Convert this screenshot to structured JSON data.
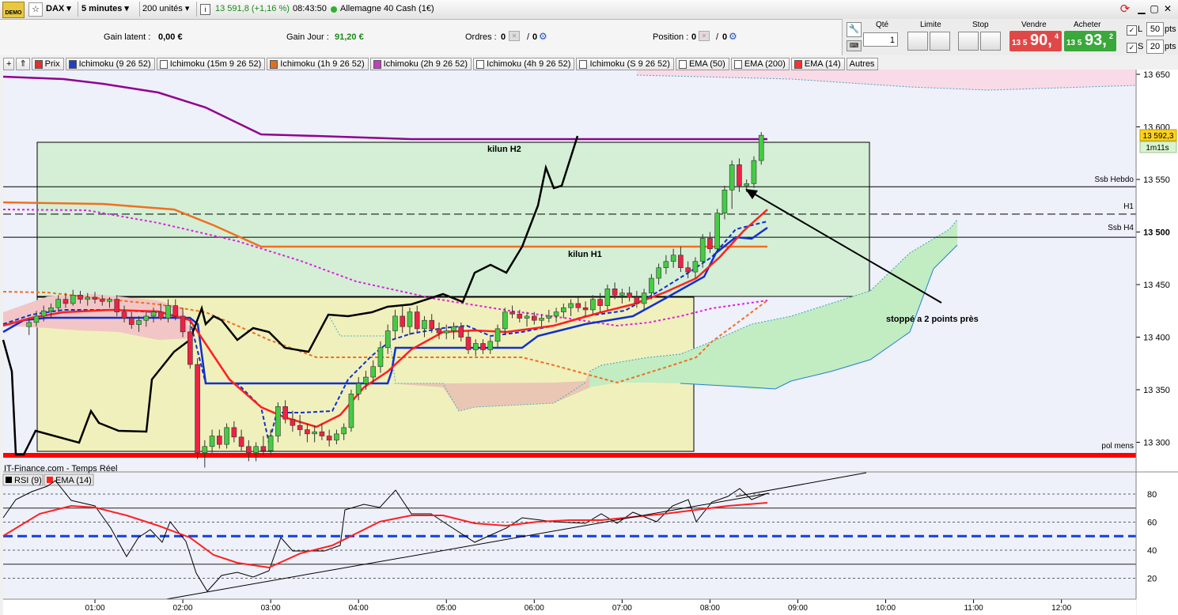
{
  "toolbar": {
    "symbol": "DAX",
    "timeframe": "5 minutes",
    "units": "200 unités",
    "price": "13 591,8",
    "change": "(+1,16 %)",
    "time": "08:43:50",
    "instrument": "Allemagne 40 Cash (1€)"
  },
  "info": {
    "gain_latent_label": "Gain latent :",
    "gain_latent": "0,00 €",
    "gain_jour_label": "Gain Jour :",
    "gain_jour": "91,20 €",
    "ordres_label": "Ordres :",
    "ordres_a": "0",
    "ordres_b": "0",
    "position_label": "Position :",
    "position_a": "0",
    "position_b": "0"
  },
  "trade": {
    "qty_label": "Qté",
    "qty_value": "1",
    "limit_label": "Limite",
    "stop_label": "Stop",
    "sell_label": "Vendre",
    "sell_small": "13 5",
    "sell_big": "90,",
    "sell_sup": "4",
    "buy_label": "Acheter",
    "buy_small": "13 5",
    "buy_big": "93,",
    "buy_sup": "2",
    "l_label": "L",
    "l_value": "50",
    "s_label": "S",
    "s_value": "20",
    "pts": "pts"
  },
  "legend": [
    {
      "label": "Prix",
      "color": "#e03030"
    },
    {
      "label": "Ichimoku (9 26 52)",
      "color": "#2040c0"
    },
    {
      "label": "Ichimoku (15m 9 26 52)",
      "color": "#ffffff"
    },
    {
      "label": "Ichimoku (1h 9 26 52)",
      "color": "#e07020"
    },
    {
      "label": "Ichimoku (2h 9 26 52)",
      "color": "#c040c0"
    },
    {
      "label": "Ichimoku (4h 9 26 52)",
      "color": "#ffffff"
    },
    {
      "label": "Ichimoku (S 9 26 52)",
      "color": "#ffffff"
    },
    {
      "label": "EMA (50)",
      "color": "#ffffff"
    },
    {
      "label": "EMA (200)",
      "color": "#ffffff"
    },
    {
      "label": "EMA (14)",
      "color": "#ff3030"
    },
    {
      "label": "Autres",
      "color": ""
    }
  ],
  "chart_data": [
    {
      "type": "line",
      "subtype": "candlestick",
      "title": "",
      "xlabel": "",
      "ylabel": "",
      "ylim": [
        13280,
        13660
      ],
      "xlim": [
        "00:10",
        "12:55"
      ],
      "x_ticks": [
        "01:00",
        "02:00",
        "03:00",
        "04:00",
        "05:00",
        "06:00",
        "07:00",
        "08:00",
        "09:00",
        "10:00",
        "11:00",
        "12:00"
      ],
      "y_ticks": [
        "13 650",
        "13 600",
        "13 550",
        "13 500",
        "13 450",
        "13 400",
        "13 350",
        "13 300"
      ],
      "current_price_label": "13 592,3",
      "countdown_label": "1m11s",
      "horizontal_levels": [
        {
          "label": "Ssb Hebdo",
          "value": 13543,
          "style": "solid"
        },
        {
          "label": "H1",
          "value": 13517,
          "style": "dashed"
        },
        {
          "label": "Ssb H4",
          "value": 13495,
          "style": "solid"
        },
        {
          "label": "pol mens",
          "value": 13286,
          "style": "thick-red"
        }
      ],
      "annotations": [
        "kilun H2",
        "kilun H1",
        "stoppé a 2 points près"
      ],
      "candles": [
        {
          "t": "00:15",
          "o": 13410,
          "h": 13418,
          "l": 13402,
          "c": 13414
        },
        {
          "t": "00:20",
          "o": 13414,
          "h": 13425,
          "l": 13410,
          "c": 13420
        },
        {
          "t": "00:25",
          "o": 13420,
          "h": 13430,
          "l": 13415,
          "c": 13425
        },
        {
          "t": "00:30",
          "o": 13425,
          "h": 13432,
          "l": 13418,
          "c": 13428
        },
        {
          "t": "00:35",
          "o": 13428,
          "h": 13440,
          "l": 13424,
          "c": 13436
        },
        {
          "t": "00:40",
          "o": 13436,
          "h": 13442,
          "l": 13428,
          "c": 13432
        },
        {
          "t": "00:45",
          "o": 13432,
          "h": 13445,
          "l": 13430,
          "c": 13440
        },
        {
          "t": "00:50",
          "o": 13440,
          "h": 13444,
          "l": 13432,
          "c": 13436
        },
        {
          "t": "00:55",
          "o": 13436,
          "h": 13442,
          "l": 13430,
          "c": 13438
        },
        {
          "t": "01:00",
          "o": 13438,
          "h": 13443,
          "l": 13432,
          "c": 13436
        },
        {
          "t": "01:05",
          "o": 13436,
          "h": 13440,
          "l": 13430,
          "c": 13434
        },
        {
          "t": "01:10",
          "o": 13434,
          "h": 13438,
          "l": 13428,
          "c": 13436
        },
        {
          "t": "01:15",
          "o": 13436,
          "h": 13440,
          "l": 13420,
          "c": 13424
        },
        {
          "t": "01:20",
          "o": 13424,
          "h": 13430,
          "l": 13414,
          "c": 13418
        },
        {
          "t": "01:25",
          "o": 13418,
          "h": 13424,
          "l": 13408,
          "c": 13412
        },
        {
          "t": "01:30",
          "o": 13412,
          "h": 13420,
          "l": 13405,
          "c": 13416
        },
        {
          "t": "01:35",
          "o": 13416,
          "h": 13424,
          "l": 13410,
          "c": 13420
        },
        {
          "t": "01:40",
          "o": 13420,
          "h": 13428,
          "l": 13414,
          "c": 13424
        },
        {
          "t": "01:45",
          "o": 13424,
          "h": 13432,
          "l": 13416,
          "c": 13418
        },
        {
          "t": "01:50",
          "o": 13418,
          "h": 13436,
          "l": 13414,
          "c": 13430
        },
        {
          "t": "01:55",
          "o": 13430,
          "h": 13436,
          "l": 13416,
          "c": 13420
        },
        {
          "t": "02:00",
          "o": 13420,
          "h": 13428,
          "l": 13400,
          "c": 13405
        },
        {
          "t": "02:05",
          "o": 13405,
          "h": 13412,
          "l": 13370,
          "c": 13374
        },
        {
          "t": "02:10",
          "o": 13374,
          "h": 13380,
          "l": 13284,
          "c": 13290
        },
        {
          "t": "02:15",
          "o": 13290,
          "h": 13302,
          "l": 13276,
          "c": 13296
        },
        {
          "t": "02:20",
          "o": 13296,
          "h": 13312,
          "l": 13290,
          "c": 13306
        },
        {
          "t": "02:25",
          "o": 13306,
          "h": 13312,
          "l": 13294,
          "c": 13298
        },
        {
          "t": "02:30",
          "o": 13298,
          "h": 13318,
          "l": 13294,
          "c": 13314
        },
        {
          "t": "02:35",
          "o": 13314,
          "h": 13320,
          "l": 13300,
          "c": 13305
        },
        {
          "t": "02:40",
          "o": 13305,
          "h": 13312,
          "l": 13292,
          "c": 13296
        },
        {
          "t": "02:45",
          "o": 13296,
          "h": 13302,
          "l": 13282,
          "c": 13290
        },
        {
          "t": "02:50",
          "o": 13290,
          "h": 13300,
          "l": 13282,
          "c": 13296
        },
        {
          "t": "02:55",
          "o": 13296,
          "h": 13306,
          "l": 13288,
          "c": 13292
        },
        {
          "t": "03:00",
          "o": 13292,
          "h": 13312,
          "l": 13288,
          "c": 13306
        },
        {
          "t": "03:05",
          "o": 13306,
          "h": 13338,
          "l": 13300,
          "c": 13334
        },
        {
          "t": "03:10",
          "o": 13334,
          "h": 13340,
          "l": 13318,
          "c": 13322
        },
        {
          "t": "03:15",
          "o": 13322,
          "h": 13330,
          "l": 13310,
          "c": 13316
        },
        {
          "t": "03:20",
          "o": 13316,
          "h": 13326,
          "l": 13306,
          "c": 13312
        },
        {
          "t": "03:25",
          "o": 13312,
          "h": 13318,
          "l": 13300,
          "c": 13308
        },
        {
          "t": "03:30",
          "o": 13308,
          "h": 13316,
          "l": 13300,
          "c": 13310
        },
        {
          "t": "03:35",
          "o": 13310,
          "h": 13318,
          "l": 13302,
          "c": 13306
        },
        {
          "t": "03:40",
          "o": 13306,
          "h": 13312,
          "l": 13296,
          "c": 13302
        },
        {
          "t": "03:45",
          "o": 13302,
          "h": 13312,
          "l": 13298,
          "c": 13308
        },
        {
          "t": "03:50",
          "o": 13308,
          "h": 13318,
          "l": 13302,
          "c": 13314
        },
        {
          "t": "03:55",
          "o": 13314,
          "h": 13350,
          "l": 13310,
          "c": 13346
        },
        {
          "t": "04:00",
          "o": 13346,
          "h": 13362,
          "l": 13340,
          "c": 13356
        },
        {
          "t": "04:05",
          "o": 13356,
          "h": 13368,
          "l": 13350,
          "c": 13362
        },
        {
          "t": "04:10",
          "o": 13362,
          "h": 13378,
          "l": 13356,
          "c": 13372
        },
        {
          "t": "04:15",
          "o": 13372,
          "h": 13396,
          "l": 13366,
          "c": 13390
        },
        {
          "t": "04:20",
          "o": 13390,
          "h": 13412,
          "l": 13384,
          "c": 13406
        },
        {
          "t": "04:25",
          "o": 13406,
          "h": 13426,
          "l": 13398,
          "c": 13420
        },
        {
          "t": "04:30",
          "o": 13420,
          "h": 13430,
          "l": 13404,
          "c": 13410
        },
        {
          "t": "04:35",
          "o": 13410,
          "h": 13428,
          "l": 13402,
          "c": 13424
        },
        {
          "t": "04:40",
          "o": 13424,
          "h": 13430,
          "l": 13404,
          "c": 13408
        },
        {
          "t": "04:45",
          "o": 13408,
          "h": 13420,
          "l": 13400,
          "c": 13416
        },
        {
          "t": "04:50",
          "o": 13416,
          "h": 13422,
          "l": 13404,
          "c": 13408
        },
        {
          "t": "04:55",
          "o": 13408,
          "h": 13414,
          "l": 13398,
          "c": 13404
        },
        {
          "t": "05:00",
          "o": 13404,
          "h": 13412,
          "l": 13398,
          "c": 13406
        },
        {
          "t": "05:05",
          "o": 13406,
          "h": 13414,
          "l": 13398,
          "c": 13410
        },
        {
          "t": "05:10",
          "o": 13410,
          "h": 13414,
          "l": 13396,
          "c": 13400
        },
        {
          "t": "05:15",
          "o": 13400,
          "h": 13406,
          "l": 13384,
          "c": 13388
        },
        {
          "t": "05:20",
          "o": 13388,
          "h": 13398,
          "l": 13382,
          "c": 13394
        },
        {
          "t": "05:25",
          "o": 13394,
          "h": 13398,
          "l": 13384,
          "c": 13388
        },
        {
          "t": "05:30",
          "o": 13388,
          "h": 13400,
          "l": 13384,
          "c": 13396
        },
        {
          "t": "05:35",
          "o": 13396,
          "h": 13412,
          "l": 13390,
          "c": 13408
        },
        {
          "t": "05:40",
          "o": 13408,
          "h": 13428,
          "l": 13402,
          "c": 13424
        },
        {
          "t": "05:45",
          "o": 13424,
          "h": 13430,
          "l": 13418,
          "c": 13422
        },
        {
          "t": "05:50",
          "o": 13422,
          "h": 13426,
          "l": 13414,
          "c": 13418
        },
        {
          "t": "05:55",
          "o": 13418,
          "h": 13424,
          "l": 13410,
          "c": 13420
        },
        {
          "t": "06:00",
          "o": 13420,
          "h": 13424,
          "l": 13412,
          "c": 13416
        },
        {
          "t": "06:05",
          "o": 13416,
          "h": 13422,
          "l": 13410,
          "c": 13418
        },
        {
          "t": "06:10",
          "o": 13418,
          "h": 13426,
          "l": 13414,
          "c": 13420
        },
        {
          "t": "06:15",
          "o": 13420,
          "h": 13428,
          "l": 13414,
          "c": 13424
        },
        {
          "t": "06:20",
          "o": 13424,
          "h": 13432,
          "l": 13418,
          "c": 13428
        },
        {
          "t": "06:25",
          "o": 13428,
          "h": 13436,
          "l": 13420,
          "c": 13432
        },
        {
          "t": "06:30",
          "o": 13432,
          "h": 13438,
          "l": 13424,
          "c": 13428
        },
        {
          "t": "06:35",
          "o": 13428,
          "h": 13434,
          "l": 13420,
          "c": 13426
        },
        {
          "t": "06:40",
          "o": 13426,
          "h": 13440,
          "l": 13422,
          "c": 13436
        },
        {
          "t": "06:45",
          "o": 13436,
          "h": 13442,
          "l": 13424,
          "c": 13430
        },
        {
          "t": "06:50",
          "o": 13430,
          "h": 13450,
          "l": 13426,
          "c": 13446
        },
        {
          "t": "06:55",
          "o": 13446,
          "h": 13452,
          "l": 13436,
          "c": 13440
        },
        {
          "t": "07:00",
          "o": 13440,
          "h": 13446,
          "l": 13432,
          "c": 13442
        },
        {
          "t": "07:05",
          "o": 13442,
          "h": 13448,
          "l": 13434,
          "c": 13438
        },
        {
          "t": "07:10",
          "o": 13438,
          "h": 13444,
          "l": 13428,
          "c": 13432
        },
        {
          "t": "07:15",
          "o": 13432,
          "h": 13446,
          "l": 13426,
          "c": 13442
        },
        {
          "t": "07:20",
          "o": 13442,
          "h": 13460,
          "l": 13436,
          "c": 13456
        },
        {
          "t": "07:25",
          "o": 13456,
          "h": 13470,
          "l": 13450,
          "c": 13466
        },
        {
          "t": "07:30",
          "o": 13466,
          "h": 13478,
          "l": 13460,
          "c": 13472
        },
        {
          "t": "07:35",
          "o": 13472,
          "h": 13484,
          "l": 13466,
          "c": 13478
        },
        {
          "t": "07:40",
          "o": 13478,
          "h": 13486,
          "l": 13462,
          "c": 13466
        },
        {
          "t": "07:45",
          "o": 13466,
          "h": 13472,
          "l": 13456,
          "c": 13462
        },
        {
          "t": "07:50",
          "o": 13462,
          "h": 13476,
          "l": 13456,
          "c": 13472
        },
        {
          "t": "07:55",
          "o": 13472,
          "h": 13498,
          "l": 13466,
          "c": 13494
        },
        {
          "t": "08:00",
          "o": 13494,
          "h": 13500,
          "l": 13480,
          "c": 13484
        },
        {
          "t": "08:05",
          "o": 13484,
          "h": 13522,
          "l": 13480,
          "c": 13518
        },
        {
          "t": "08:10",
          "o": 13518,
          "h": 13544,
          "l": 13512,
          "c": 13540
        },
        {
          "t": "08:15",
          "o": 13540,
          "h": 13568,
          "l": 13522,
          "c": 13564
        },
        {
          "t": "08:20",
          "o": 13564,
          "h": 13570,
          "l": 13538,
          "c": 13544
        },
        {
          "t": "08:25",
          "o": 13544,
          "h": 13550,
          "l": 13538,
          "c": 13546
        },
        {
          "t": "08:30",
          "o": 13546,
          "h": 13572,
          "l": 13542,
          "c": 13568
        },
        {
          "t": "08:35",
          "o": 13568,
          "h": 13595,
          "l": 13564,
          "c": 13592
        }
      ]
    },
    {
      "type": "line",
      "title": "IT-Finance.com - Temps Réel",
      "ylim": [
        10,
        90
      ],
      "y_ticks": [
        "80",
        "60",
        "40",
        "20"
      ],
      "series": [
        {
          "name": "RSI (9)",
          "color": "#000000"
        },
        {
          "name": "EMA (14)",
          "color": "#ff2020"
        }
      ]
    }
  ]
}
